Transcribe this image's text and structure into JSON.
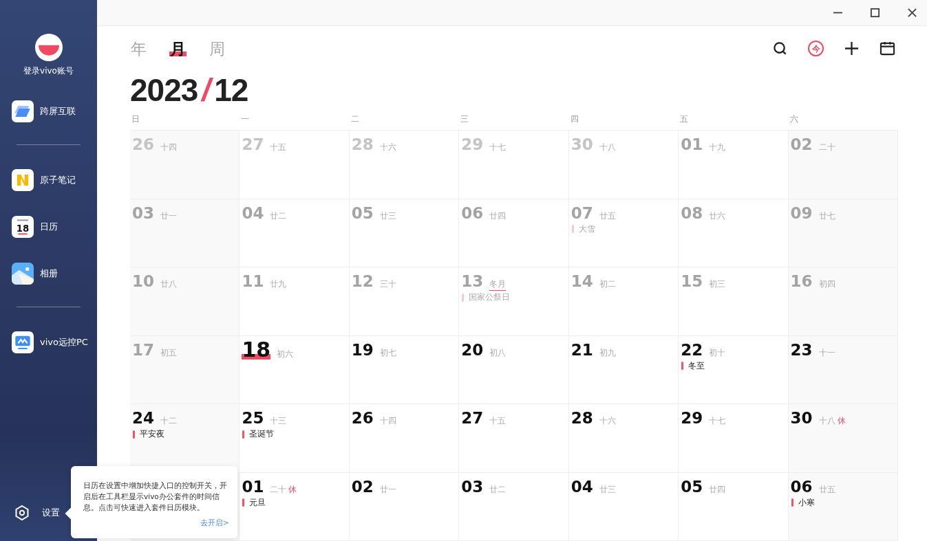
{
  "sidebar": {
    "account": {
      "label": "登录vivo账号"
    },
    "items": [
      {
        "kind": "app",
        "label": "跨屏互联"
      },
      {
        "kind": "divider"
      },
      {
        "kind": "app",
        "label": "原子笔记"
      },
      {
        "kind": "app",
        "label": "日历",
        "icon_text": "18"
      },
      {
        "kind": "app",
        "label": "相册"
      },
      {
        "kind": "divider"
      },
      {
        "kind": "app",
        "label": "vivo远控PC"
      }
    ],
    "settings": {
      "label": "设置"
    }
  },
  "view_tabs": [
    {
      "label": "年",
      "selected": false
    },
    {
      "label": "月",
      "selected": true
    },
    {
      "label": "周",
      "selected": false
    }
  ],
  "toolbar": {
    "today_button": "今"
  },
  "heading": {
    "year": "2023",
    "separator": "/",
    "month": "12"
  },
  "weekdays": [
    "日",
    "一",
    "二",
    "三",
    "四",
    "五",
    "六"
  ],
  "days": [
    {
      "kind": "day",
      "day": "26",
      "lunar": "十四",
      "faded": true,
      "past": true,
      "today": false
    },
    {
      "kind": "day",
      "day": "27",
      "lunar": "十五",
      "faded": true,
      "past": true,
      "today": false
    },
    {
      "kind": "day",
      "day": "28",
      "lunar": "十六",
      "faded": true,
      "past": true,
      "today": false
    },
    {
      "kind": "day",
      "day": "29",
      "lunar": "十七",
      "faded": true,
      "past": true,
      "today": false
    },
    {
      "kind": "day",
      "day": "30",
      "lunar": "十八",
      "faded": true,
      "past": true,
      "today": false
    },
    {
      "kind": "day",
      "day": "01",
      "lunar": "十九",
      "faded": false,
      "past": true,
      "today": false
    },
    {
      "kind": "day",
      "day": "02",
      "lunar": "二十",
      "faded": false,
      "past": true,
      "today": false
    },
    {
      "kind": "day",
      "day": "03",
      "lunar": "廿一",
      "faded": false,
      "past": true,
      "today": false
    },
    {
      "kind": "day",
      "day": "04",
      "lunar": "廿二",
      "faded": false,
      "past": true,
      "today": false
    },
    {
      "kind": "day",
      "day": "05",
      "lunar": "廿三",
      "faded": false,
      "past": true,
      "today": false
    },
    {
      "kind": "day",
      "day": "06",
      "lunar": "廿四",
      "faded": false,
      "past": true,
      "today": false
    },
    {
      "kind": "day",
      "day": "07",
      "lunar": "廿五",
      "faded": false,
      "past": true,
      "today": false,
      "event": "大雪"
    },
    {
      "kind": "day",
      "day": "08",
      "lunar": "廿六",
      "faded": false,
      "past": true,
      "today": false
    },
    {
      "kind": "day",
      "day": "09",
      "lunar": "廿七",
      "faded": false,
      "past": true,
      "today": false
    },
    {
      "kind": "day",
      "day": "10",
      "lunar": "廿八",
      "faded": false,
      "past": true,
      "today": false
    },
    {
      "kind": "day",
      "day": "11",
      "lunar": "廿九",
      "faded": false,
      "past": true,
      "today": false
    },
    {
      "kind": "day",
      "day": "12",
      "lunar": "三十",
      "faded": false,
      "past": true,
      "today": false
    },
    {
      "kind": "day",
      "day": "13",
      "lunar": "冬月",
      "lunar_month_start": true,
      "faded": false,
      "past": true,
      "today": false,
      "event": "国家公祭日"
    },
    {
      "kind": "day",
      "day": "14",
      "lunar": "初二",
      "faded": false,
      "past": true,
      "today": false
    },
    {
      "kind": "day",
      "day": "15",
      "lunar": "初三",
      "faded": false,
      "past": true,
      "today": false
    },
    {
      "kind": "day",
      "day": "16",
      "lunar": "初四",
      "faded": false,
      "past": true,
      "today": false
    },
    {
      "kind": "day",
      "day": "17",
      "lunar": "初五",
      "faded": false,
      "past": true,
      "today": false
    },
    {
      "kind": "day",
      "day": "18",
      "lunar": "初六",
      "faded": false,
      "past": false,
      "today": true
    },
    {
      "kind": "day",
      "day": "19",
      "lunar": "初七",
      "faded": false,
      "past": false,
      "today": false
    },
    {
      "kind": "day",
      "day": "20",
      "lunar": "初八",
      "faded": false,
      "past": false,
      "today": false
    },
    {
      "kind": "day",
      "day": "21",
      "lunar": "初九",
      "faded": false,
      "past": false,
      "today": false
    },
    {
      "kind": "day",
      "day": "22",
      "lunar": "初十",
      "faded": false,
      "past": false,
      "today": false,
      "event": "冬至"
    },
    {
      "kind": "day",
      "day": "23",
      "lunar": "十一",
      "faded": false,
      "past": false,
      "today": false
    },
    {
      "kind": "day",
      "day": "24",
      "lunar": "十二",
      "faded": false,
      "past": false,
      "today": false,
      "event": "平安夜"
    },
    {
      "kind": "day",
      "day": "25",
      "lunar": "十三",
      "faded": false,
      "past": false,
      "today": false,
      "event": "圣诞节"
    },
    {
      "kind": "day",
      "day": "26",
      "lunar": "十四",
      "faded": false,
      "past": false,
      "today": false
    },
    {
      "kind": "day",
      "day": "27",
      "lunar": "十五",
      "faded": false,
      "past": false,
      "today": false
    },
    {
      "kind": "day",
      "day": "28",
      "lunar": "十六",
      "faded": false,
      "past": false,
      "today": false
    },
    {
      "kind": "day",
      "day": "29",
      "lunar": "十七",
      "faded": false,
      "past": false,
      "today": false
    },
    {
      "kind": "day",
      "day": "30",
      "lunar": "十八",
      "faded": false,
      "past": false,
      "today": false,
      "badge": "休"
    },
    {
      "kind": "covered"
    },
    {
      "kind": "day",
      "day": "01",
      "lunar": "二十",
      "faded": false,
      "past": false,
      "today": false,
      "badge": "休",
      "event": "元旦"
    },
    {
      "kind": "day",
      "day": "02",
      "lunar": "廿一",
      "faded": false,
      "past": false,
      "today": false
    },
    {
      "kind": "day",
      "day": "03",
      "lunar": "廿二",
      "faded": false,
      "past": false,
      "today": false
    },
    {
      "kind": "day",
      "day": "04",
      "lunar": "廿三",
      "faded": false,
      "past": false,
      "today": false
    },
    {
      "kind": "day",
      "day": "05",
      "lunar": "廿四",
      "faded": false,
      "past": false,
      "today": false
    },
    {
      "kind": "day",
      "day": "06",
      "lunar": "廿五",
      "faded": false,
      "past": false,
      "today": false,
      "event": "小寒"
    }
  ],
  "tooltip": {
    "text": "日历在设置中增加快捷入口的控制开关，开启后在工具栏显示vivo办公套件的时间信息。点击可快速进入套件日历模块。",
    "link": "去开启>"
  }
}
